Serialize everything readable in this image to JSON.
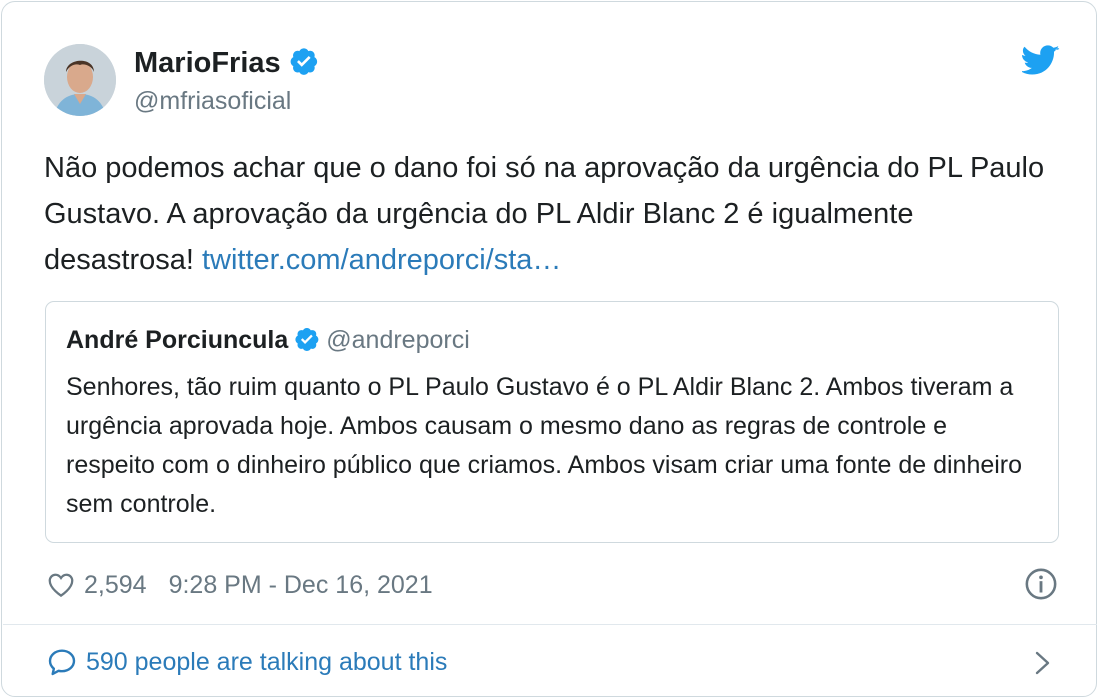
{
  "tweet": {
    "author_name": "MarioFrias",
    "author_handle": "@mfriasoficial",
    "text_main": "Não podemos achar que o dano foi só na aprovação da urgência do PL Paulo Gustavo. A aprovação da urgência do PL Aldir Blanc 2 é igualmente desastrosa!",
    "link_text": "twitter.com/andreporci/sta…",
    "likes": "2,594",
    "timestamp": "9:28 PM - Dec 16, 2021",
    "talking": "590 people are talking about this"
  },
  "quote": {
    "author_name": "André Porciuncula",
    "author_handle": "@andreporci",
    "text": "Senhores, tão ruim quanto o PL Paulo Gustavo é o PL Aldir Blanc 2. Ambos tiveram a urgência aprovada hoje. Ambos causam o mesmo dano as regras de controle e respeito com o dinheiro público que criamos. Ambos visam criar uma fonte de dinheiro sem controle."
  },
  "icons": {
    "verified": "verified-badge-icon",
    "brand": "twitter-bird-icon",
    "like": "heart-icon",
    "info": "info-icon",
    "reply": "speech-bubble-icon",
    "expand": "chevron-right-icon"
  },
  "colors": {
    "accent": "#1da1f2",
    "link": "#2b7bb9",
    "text": "#1c2022",
    "muted": "#697882",
    "border": "#cfd9de"
  }
}
